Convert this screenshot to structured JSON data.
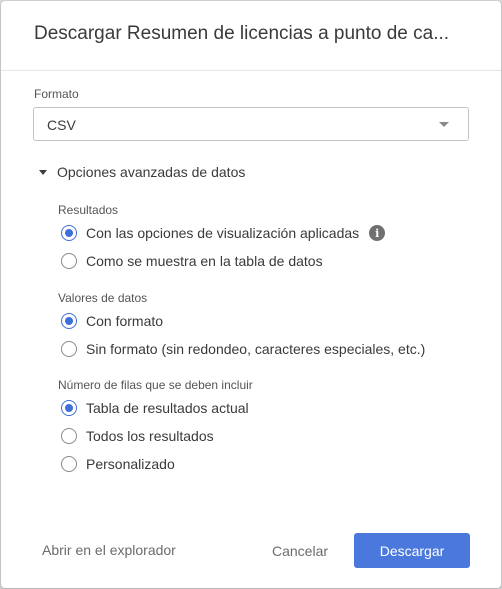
{
  "dialog": {
    "title": "Descargar Resumen de licencias a punto de ca..."
  },
  "format": {
    "label": "Formato",
    "selected": "CSV"
  },
  "advanced": {
    "toggle_label": "Opciones avanzadas de datos",
    "expanded": true
  },
  "results": {
    "label": "Resultados",
    "options": [
      {
        "label": "Con las opciones de visualización aplicadas",
        "checked": true,
        "has_info": true
      },
      {
        "label": "Como se muestra en la tabla de datos",
        "checked": false
      }
    ]
  },
  "data_values": {
    "label": "Valores de datos",
    "options": [
      {
        "label": "Con formato",
        "checked": true
      },
      {
        "label": "Sin formato (sin redondeo, caracteres especiales, etc.)",
        "checked": false
      }
    ]
  },
  "rows": {
    "label": "Número de filas que se deben incluir",
    "options": [
      {
        "label": "Tabla de resultados actual",
        "checked": true
      },
      {
        "label": "Todos los resultados",
        "checked": false
      },
      {
        "label": "Personalizado",
        "checked": false
      }
    ]
  },
  "footer": {
    "open_explorer": "Abrir en el explorador",
    "cancel": "Cancelar",
    "download": "Descargar"
  },
  "colors": {
    "accent": "#4a78dc",
    "radio_checked": "#3f6fd8"
  },
  "icons": {
    "info": "i"
  }
}
